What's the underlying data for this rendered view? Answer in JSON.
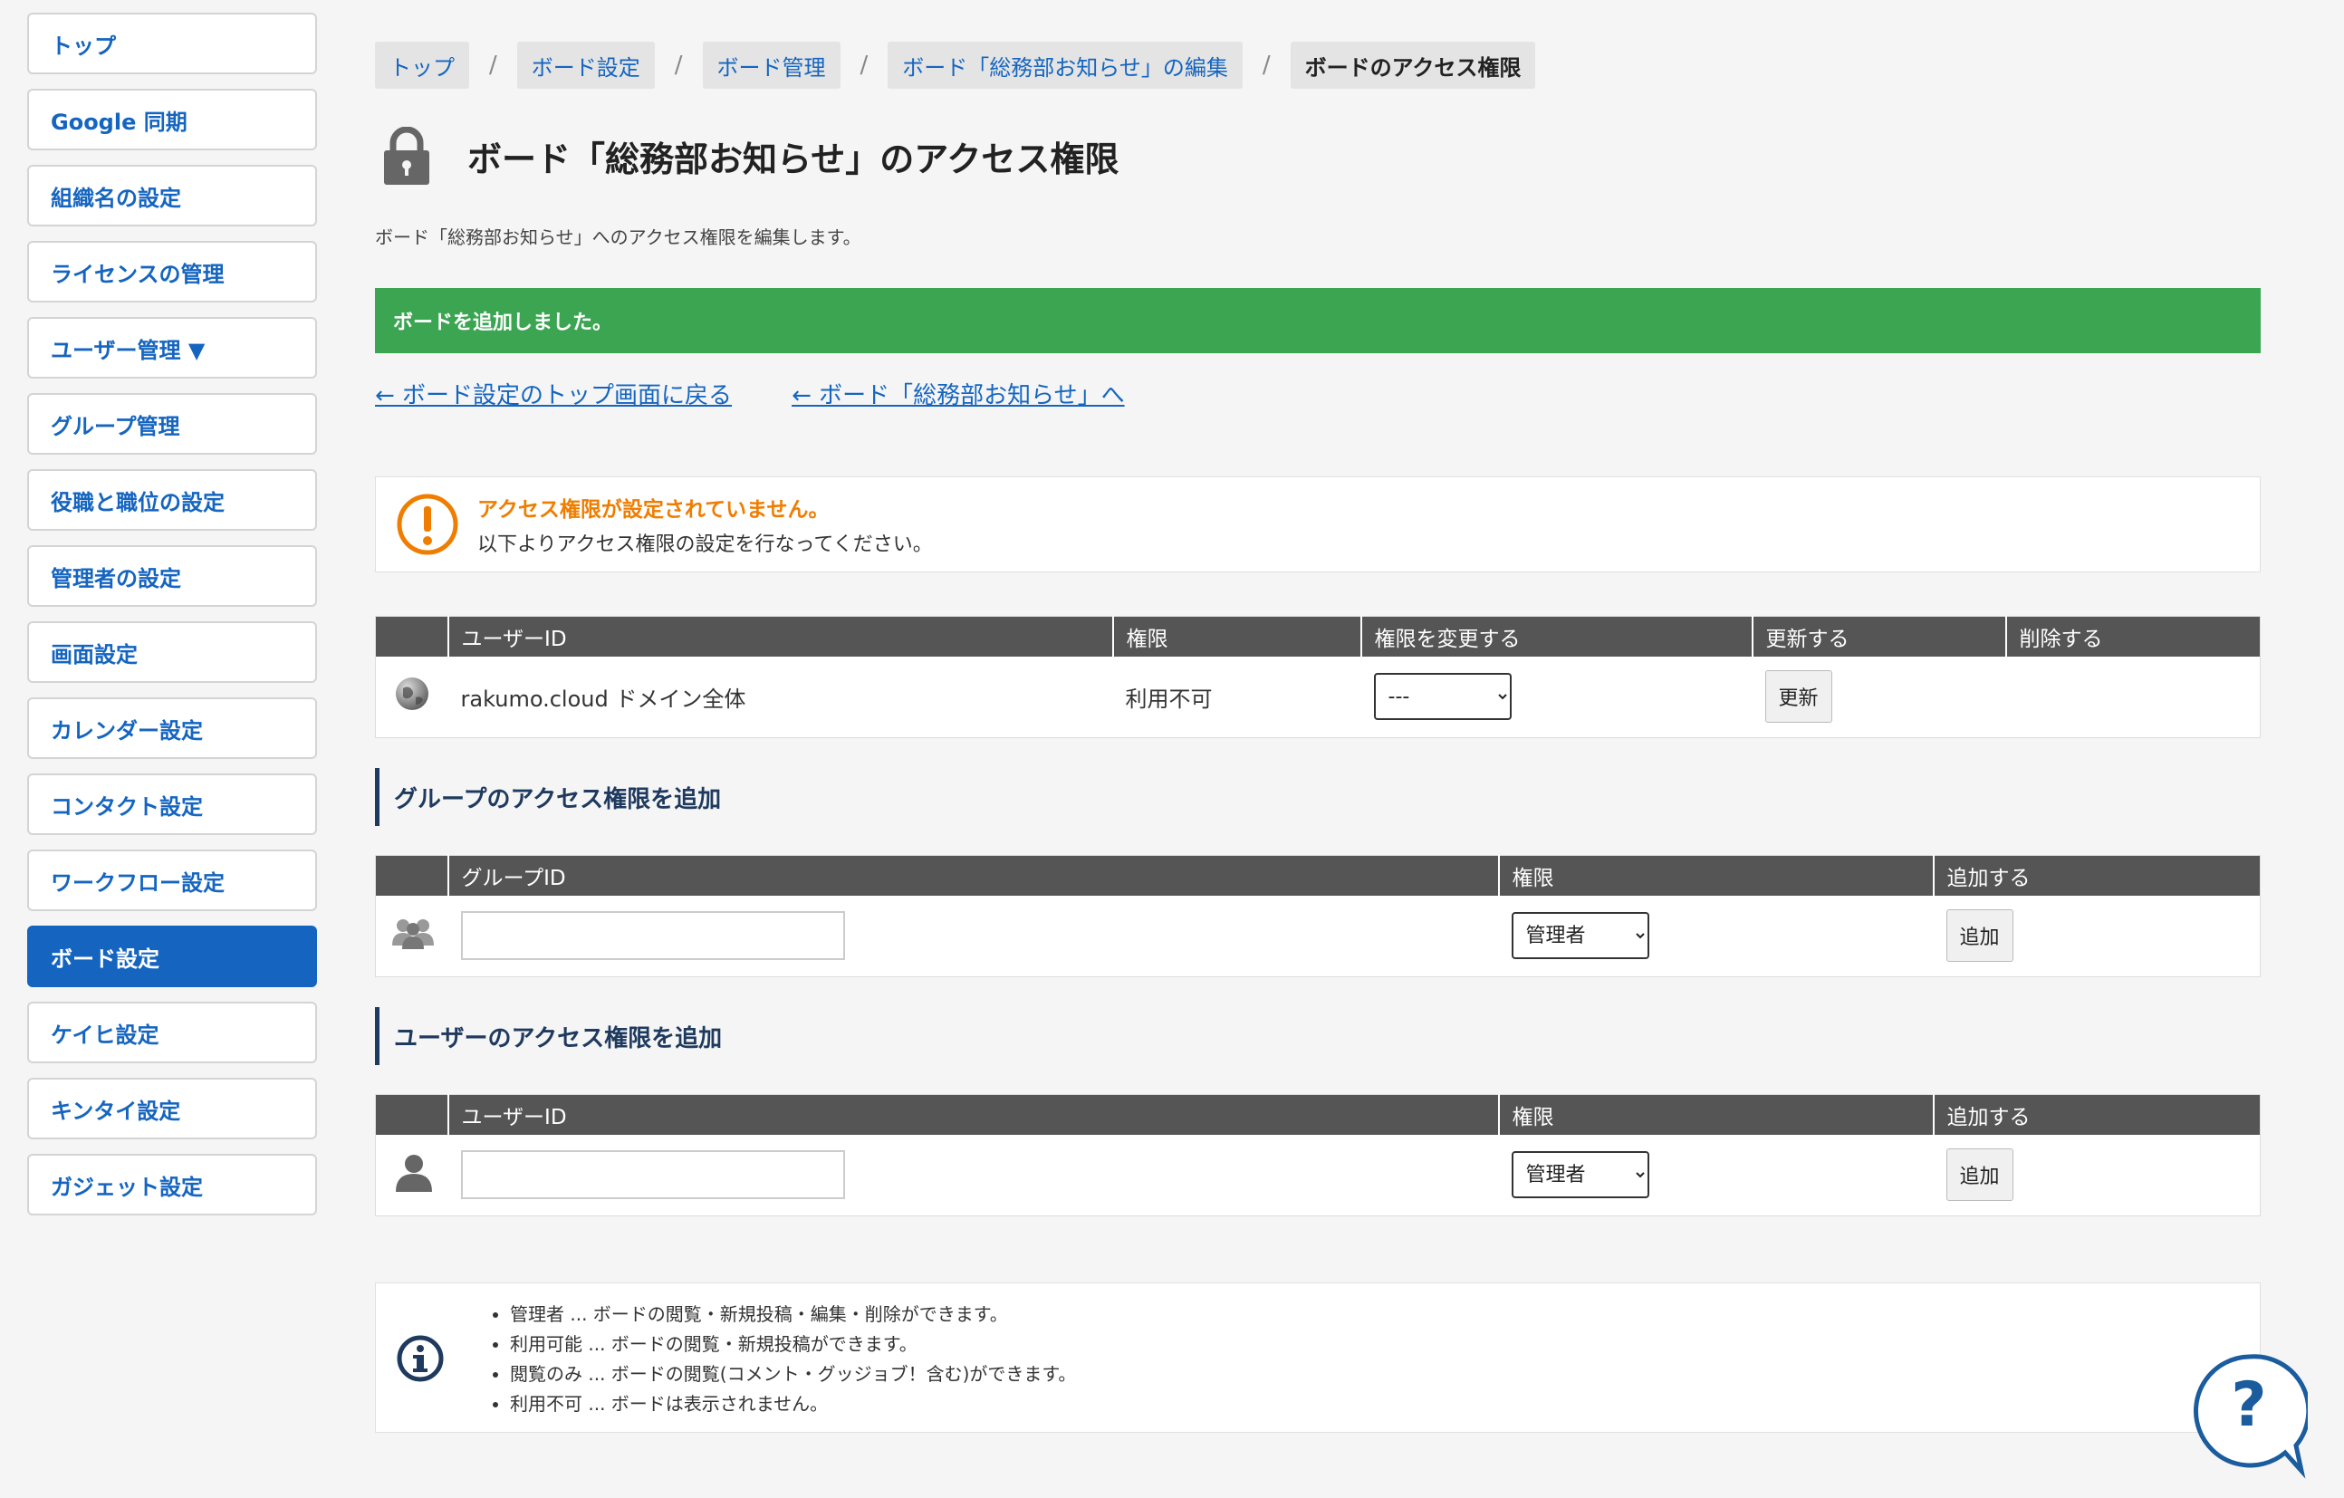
{
  "sidebar": {
    "items": [
      {
        "label": "トップ"
      },
      {
        "label": "Google 同期"
      },
      {
        "label": "組織名の設定"
      },
      {
        "label": "ライセンスの管理"
      },
      {
        "label": "ユーザー管理 ▼"
      },
      {
        "label": "グループ管理"
      },
      {
        "label": "役職と職位の設定"
      },
      {
        "label": "管理者の設定"
      },
      {
        "label": "画面設定"
      },
      {
        "label": "カレンダー設定"
      },
      {
        "label": "コンタクト設定"
      },
      {
        "label": "ワークフロー設定"
      },
      {
        "label": "ボード設定",
        "active": true
      },
      {
        "label": "ケイヒ設定"
      },
      {
        "label": "キンタイ設定"
      },
      {
        "label": "ガジェット設定"
      }
    ]
  },
  "breadcrumb": {
    "items": [
      "トップ",
      "ボード設定",
      "ボード管理",
      "ボード「総務部お知らせ」の編集",
      "ボードのアクセス権限"
    ],
    "separator": "/"
  },
  "page": {
    "title": "ボード「総務部お知らせ」のアクセス権限",
    "subtitle": "ボード「総務部お知らせ」へのアクセス権限を編集します。",
    "success_message": "ボードを追加しました。",
    "link_back_top": "← ボード設定のトップ画面に戻る",
    "link_board": "← ボード「総務部お知らせ」へ"
  },
  "alert": {
    "title": "アクセス権限が設定されていません。",
    "body": "以下よりアクセス権限の設定を行なってください。"
  },
  "permissions_table": {
    "headers": [
      "ユーザーID",
      "権限",
      "権限を変更する",
      "更新する",
      "削除する"
    ],
    "rows": [
      {
        "user_id": "rakumo.cloud ドメイン全体",
        "permission": "利用不可",
        "change_value": "---",
        "update_label": "更新"
      }
    ]
  },
  "group_section": {
    "heading": "グループのアクセス権限を追加",
    "headers": [
      "グループID",
      "権限",
      "追加する"
    ],
    "input_value": "",
    "permission_value": "管理者",
    "add_label": "追加"
  },
  "user_section": {
    "heading": "ユーザーのアクセス権限を追加",
    "headers": [
      "ユーザーID",
      "権限",
      "追加する"
    ],
    "input_value": "",
    "permission_value": "管理者",
    "add_label": "追加"
  },
  "info": {
    "items": [
      "管理者 ... ボードの閲覧・新規投稿・編集・削除ができます。",
      "利用可能 ... ボードの閲覧・新規投稿ができます。",
      "閲覧のみ ... ボードの閲覧(コメント・グッジョブ！含む)ができます。",
      "利用不可 ... ボードは表示されません。"
    ]
  },
  "help": {
    "label": "?"
  },
  "colors": {
    "accent": "#1565c0",
    "success": "#3ba552",
    "warning": "#ef7d00",
    "header_bg": "#555555",
    "section_heading": "#1f3a5f"
  }
}
